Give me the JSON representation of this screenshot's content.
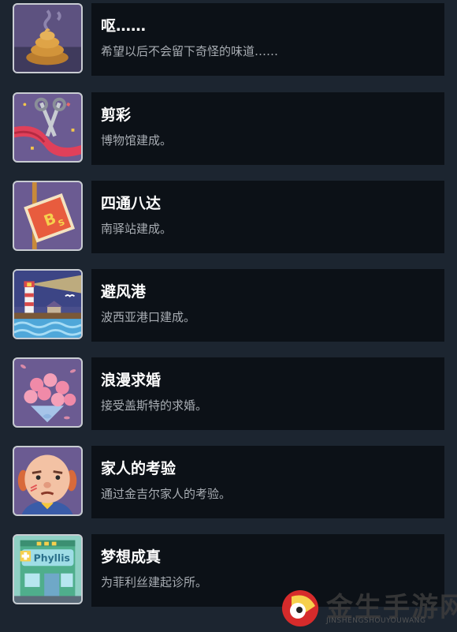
{
  "achievements": [
    {
      "title": "呕……",
      "desc": "希望以后不会留下奇怪的味道……",
      "icon": "dung-icon"
    },
    {
      "title": "剪彩",
      "desc": "博物馆建成。",
      "icon": "scissors-ribbon-icon"
    },
    {
      "title": "四通八达",
      "desc": "南驿站建成。",
      "icon": "bus-sign-icon"
    },
    {
      "title": "避风港",
      "desc": "波西亚港口建成。",
      "icon": "lighthouse-harbor-icon"
    },
    {
      "title": "浪漫求婚",
      "desc": "接受盖斯特的求婚。",
      "icon": "rose-bouquet-icon"
    },
    {
      "title": "家人的考验",
      "desc": "通过金吉尔家人的考验。",
      "icon": "bald-man-icon"
    },
    {
      "title": "梦想成真",
      "desc": "为菲利丝建起诊所。",
      "icon": "clinic-building-icon",
      "sign_text": "Phyllis"
    }
  ],
  "watermark": {
    "main": "金生手游网",
    "sub": "JINSHENGSHOUYOUWANG"
  },
  "colors": {
    "background": "#1c2530",
    "panel": "#0c1117",
    "title": "#ffffff",
    "desc": "#a8adb3"
  }
}
